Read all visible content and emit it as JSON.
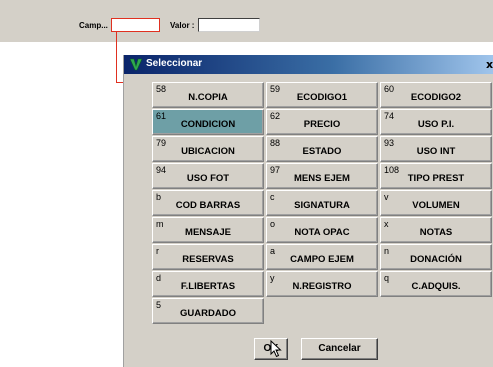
{
  "topbar": {
    "campo_label": "Camp...",
    "valor_label": "Valor :"
  },
  "dialog": {
    "title": "Seleccionar",
    "close_glyph": "x",
    "fields": [
      {
        "code": "58",
        "name": "N.COPIA"
      },
      {
        "code": "59",
        "name": "ECODIGO1"
      },
      {
        "code": "60",
        "name": "ECODIGO2"
      },
      {
        "code": "61",
        "name": "CONDICION",
        "selected": true
      },
      {
        "code": "62",
        "name": "PRECIO"
      },
      {
        "code": "74",
        "name": "USO P.I."
      },
      {
        "code": "79",
        "name": "UBICACION"
      },
      {
        "code": "88",
        "name": "ESTADO"
      },
      {
        "code": "93",
        "name": "USO INT"
      },
      {
        "code": "94",
        "name": "USO FOT"
      },
      {
        "code": "97",
        "name": "MENS EJEM"
      },
      {
        "code": "108",
        "name": "TIPO PREST"
      },
      {
        "code": "b",
        "name": "COD BARRAS"
      },
      {
        "code": "c",
        "name": "SIGNATURA"
      },
      {
        "code": "v",
        "name": "VOLUMEN"
      },
      {
        "code": "m",
        "name": "MENSAJE"
      },
      {
        "code": "o",
        "name": "NOTA OPAC"
      },
      {
        "code": "x",
        "name": "NOTAS"
      },
      {
        "code": "r",
        "name": "RESERVAS"
      },
      {
        "code": "a",
        "name": "CAMPO EJEM"
      },
      {
        "code": "n",
        "name": "DONACIÓN"
      },
      {
        "code": "d",
        "name": "F.LIBERTAS"
      },
      {
        "code": "y",
        "name": "N.REGISTRO"
      },
      {
        "code": "q",
        "name": "C.ADQUIS."
      },
      {
        "code": "5",
        "name": "GUARDADO"
      }
    ],
    "ok_label": "OK",
    "cancel_label": "Cancelar"
  },
  "colors": {
    "titlebar_start": "#0a246a",
    "selected_cell": "#6e9fa6",
    "highlight_border": "#e03020"
  },
  "icons": [
    "app-v-icon",
    "mouse-pointer-icon"
  ]
}
